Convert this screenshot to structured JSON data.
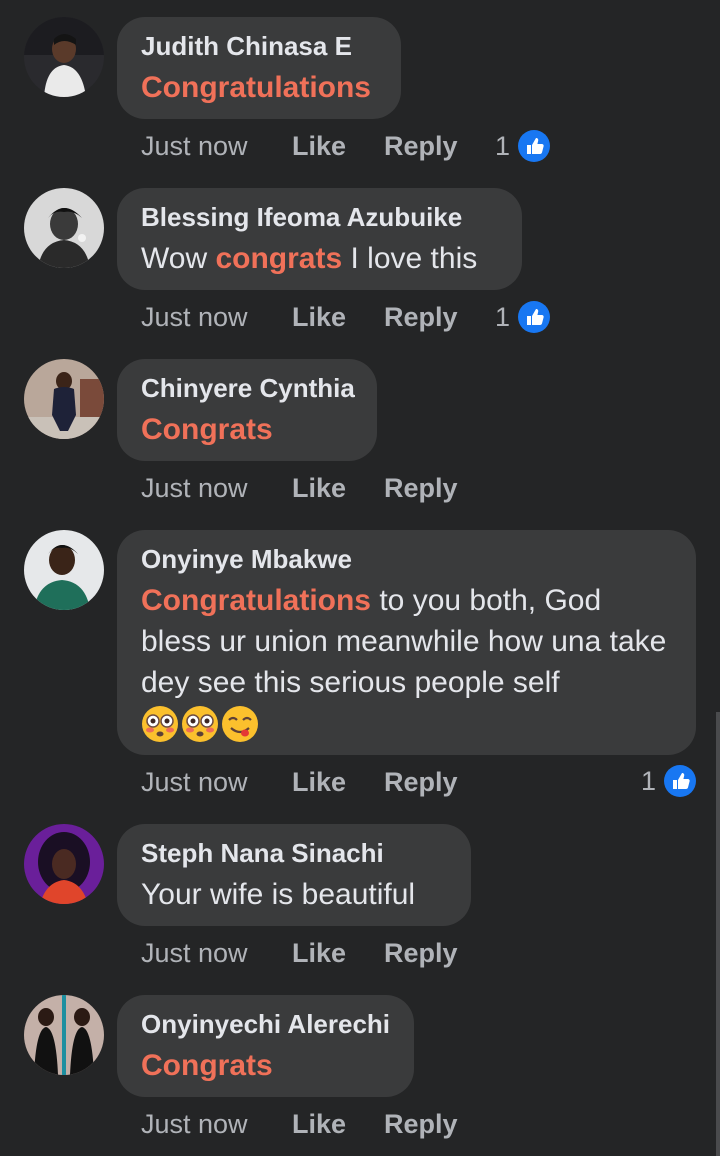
{
  "comments": [
    {
      "author": "Judith Chinasa E",
      "segments": [
        {
          "text": "Congratulations",
          "mention": true
        }
      ],
      "time": "Just now",
      "like_label": "Like",
      "reply_label": "Reply",
      "reaction_count": "1"
    },
    {
      "author": "Blessing Ifeoma Azubuike",
      "segments": [
        {
          "text": "Wow ",
          "mention": false
        },
        {
          "text": "congrats",
          "mention": true
        },
        {
          "text": " I love this",
          "mention": false
        }
      ],
      "time": "Just now",
      "like_label": "Like",
      "reply_label": "Reply",
      "reaction_count": "1"
    },
    {
      "author": "Chinyere Cynthia",
      "segments": [
        {
          "text": "Congrats",
          "mention": true
        }
      ],
      "time": "Just now",
      "like_label": "Like",
      "reply_label": "Reply",
      "reaction_count": ""
    },
    {
      "author": "Onyinye Mbakwe",
      "segments": [
        {
          "text": "Congratulations",
          "mention": true
        },
        {
          "text": " to you both, God bless ur union meanwhile how una take dey see this serious people self",
          "mention": false
        }
      ],
      "emojis": [
        "flushed-face",
        "flushed-face",
        "face-savoring-food"
      ],
      "time": "Just now",
      "like_label": "Like",
      "reply_label": "Reply",
      "reaction_count": "1"
    },
    {
      "author": "Steph Nana Sinachi",
      "segments": [
        {
          "text": "Your wife is beautiful",
          "mention": false
        }
      ],
      "time": "Just now",
      "like_label": "Like",
      "reply_label": "Reply",
      "reaction_count": ""
    },
    {
      "author": "Onyinyechi Alerechi",
      "segments": [
        {
          "text": "Congrats",
          "mention": true
        }
      ],
      "time": "Just now",
      "like_label": "Like",
      "reply_label": "Reply",
      "reaction_count": ""
    }
  ],
  "colors": {
    "background": "#242526",
    "bubble": "#3a3b3c",
    "mention": "#f07159",
    "secondary_text": "#b0b3b8",
    "like_blue": "#1877f2"
  }
}
